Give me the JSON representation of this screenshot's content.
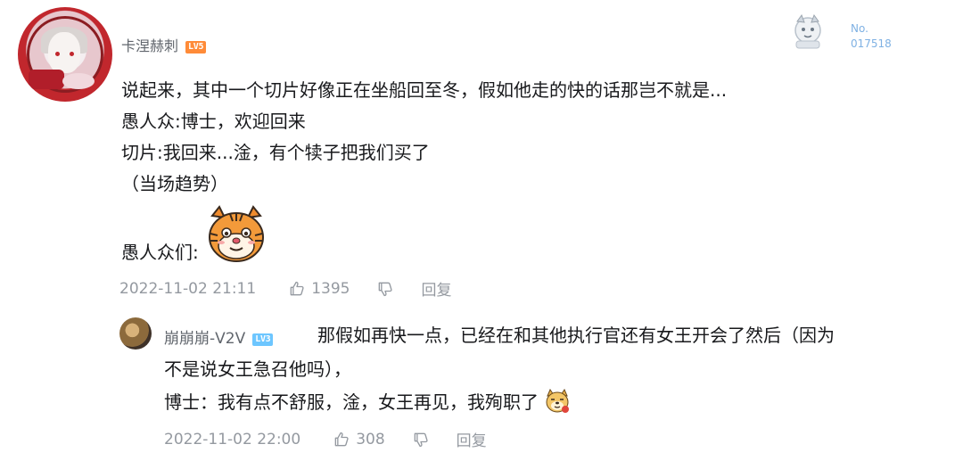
{
  "comment": {
    "username": "卡涅赫刺",
    "level_badge": "LV5",
    "fan_no_prefix": "No.",
    "fan_no": "017518",
    "lines": [
      "说起来，其中一个切片好像正在坐船回至冬，假如他走的快的话那岂不就是...",
      "愚人众:博士，欢迎回来",
      "切片:我回来...淦，有个犊子把我们买了",
      "（当场趋势）",
      "愚人众们:"
    ],
    "timestamp": "2022-11-02 21:11",
    "likes": "1395",
    "reply_label": "回复"
  },
  "reply": {
    "username": "崩崩崩-V2V",
    "level_badge": "LV3",
    "lines": [
      "那假如再快一点，已经在和其他执行官还有女王开会了然后（因为",
      "不是说女王急召他吗），",
      "博士：我有点不舒服，淦，女王再见，我殉职了"
    ],
    "timestamp": "2022-11-02 22:00",
    "likes": "308",
    "reply_label": "回复"
  },
  "colors": {
    "meta_gray": "#9499a0",
    "username_gray": "#61666d",
    "lv5_orange": "#ff8b38",
    "lv3_blue": "#6dc6ff",
    "fan_no_blue": "#7fb1e3"
  },
  "icons": {
    "like": "thumb-up-outline",
    "dislike": "thumb-down-outline",
    "sticker_tiger": "tiger-face-sticker",
    "emoji_doge": "doge-emoji"
  }
}
